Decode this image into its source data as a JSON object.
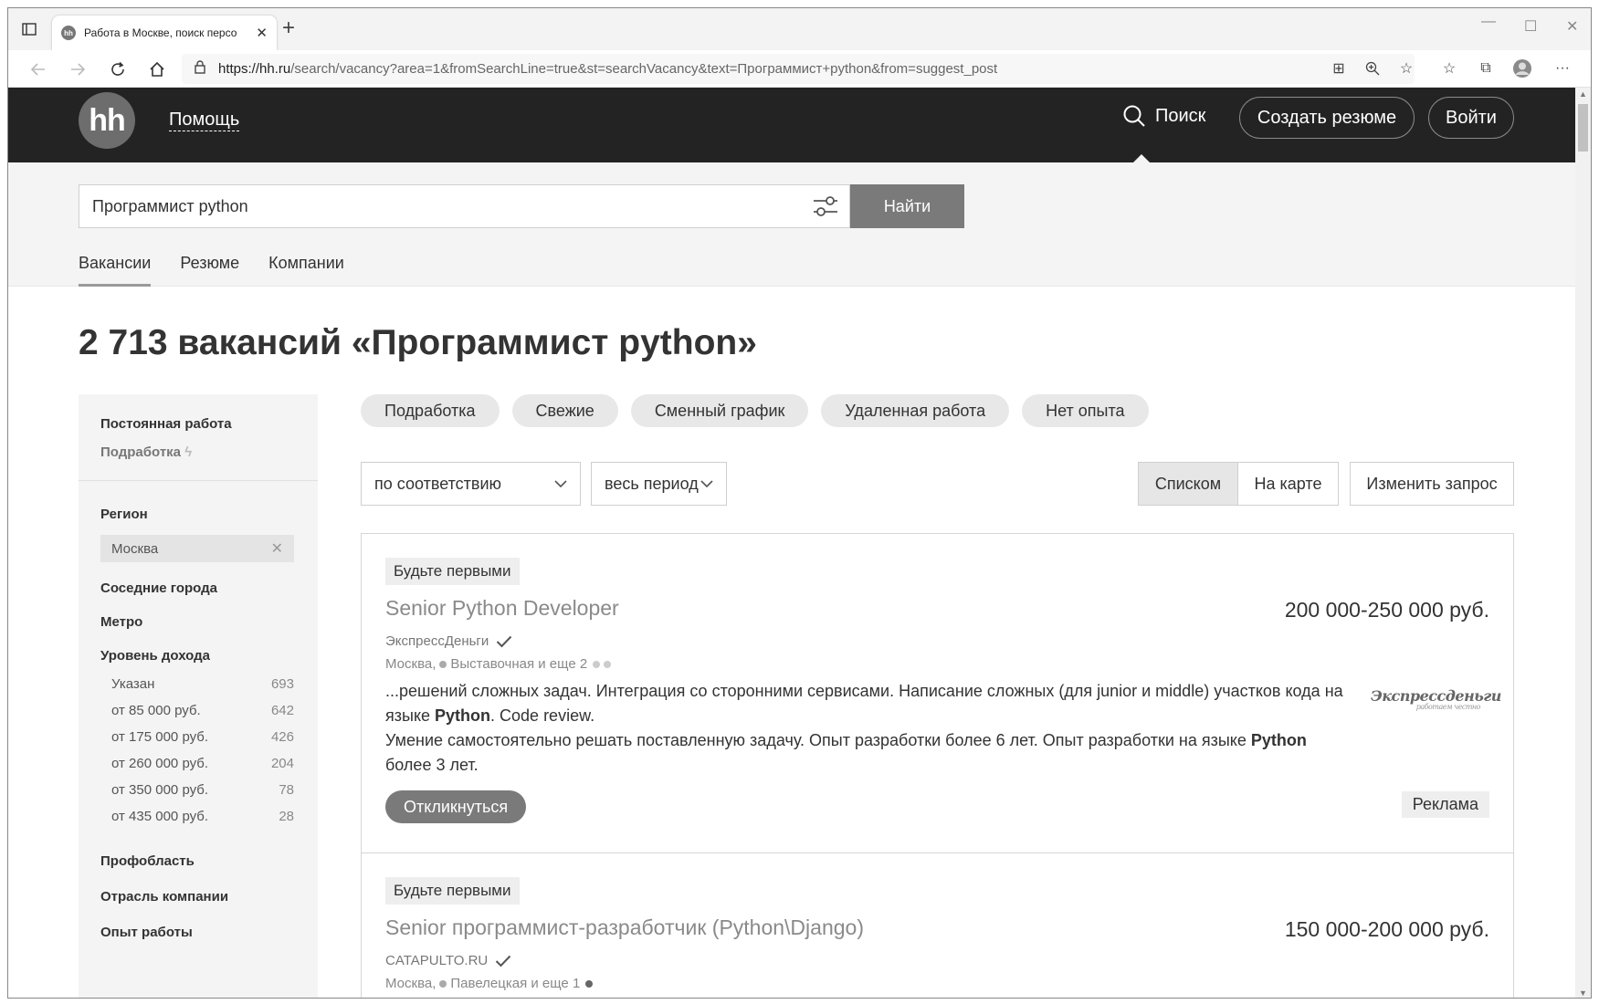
{
  "browser": {
    "tab_title": "Работа в Москве, поиск персо",
    "tab_favicon": "hh",
    "url_host": "https://hh.ru",
    "url_rest": "/search/vacancy?area=1&fromSearchLine=true&st=searchVacancy&text=Программист+python&from=suggest_post",
    "new_tab": "+",
    "close_tab": "✕"
  },
  "header": {
    "logo": "hh",
    "help": "Помощь",
    "search": "Поиск",
    "create_resume": "Создать резюме",
    "login": "Войти"
  },
  "search": {
    "query": "Программист python",
    "find_button": "Найти",
    "tabs": [
      "Вакансии",
      "Резюме",
      "Компании"
    ]
  },
  "results": {
    "title": "2 713 вакансий «Программист python»"
  },
  "sidebar": {
    "employment_type": "Постоянная работа",
    "part_time": "Подработка",
    "region_label": "Регион",
    "region_value": "Москва",
    "nearby_cities": "Соседние города",
    "metro": "Метро",
    "income_label": "Уровень дохода",
    "income": [
      {
        "label": "Указан",
        "count": "693"
      },
      {
        "label": "от 85 000 руб.",
        "count": "642"
      },
      {
        "label": "от 175 000 руб.",
        "count": "426"
      },
      {
        "label": "от 260 000 руб.",
        "count": "204"
      },
      {
        "label": "от 350 000 руб.",
        "count": "78"
      },
      {
        "label": "от 435 000 руб.",
        "count": "28"
      }
    ],
    "profarea": "Профобласть",
    "industry": "Отрасль компании",
    "experience": "Опыт работы"
  },
  "chips": [
    "Подработка",
    "Свежие",
    "Сменный график",
    "Удаленная работа",
    "Нет опыта"
  ],
  "sort": {
    "order": "по соответствию",
    "period": "весь период",
    "view_list": "Списком",
    "view_map": "На карте",
    "change_query": "Изменить запрос"
  },
  "vacancies": [
    {
      "badge": "Будьте первыми",
      "title": "Senior Python Developer",
      "salary": "200 000-250 000 руб.",
      "employer": "ЭкспрессДеньги",
      "city": "Москва,",
      "metro": "Выставочная и еще 2",
      "snippet_1a": "...решений сложных задач. Интеграция со сторонними сервисами. Написание сложных (для junior и middle) участков кода на языке ",
      "snippet_1b": "Python",
      "snippet_1c": ". Code review.",
      "snippet_2a": "Умение самостоятельно решать поставленную задачу. Опыт разработки более 6 лет. Опыт разработки на языке ",
      "snippet_2b": "Python",
      "snippet_2c": " более 3 лет.",
      "logo_text": "Экспрессденьги",
      "logo_sub": "работаем честно",
      "respond": "Откликнуться",
      "ad": "Реклама"
    },
    {
      "badge": "Будьте первыми",
      "title": "Senior программист-разработчик (Python\\Django)",
      "salary": "150 000-200 000 руб.",
      "employer": "CATAPULTO.RU",
      "city": "Москва,",
      "metro": "Павелецкая и еще 1"
    }
  ]
}
